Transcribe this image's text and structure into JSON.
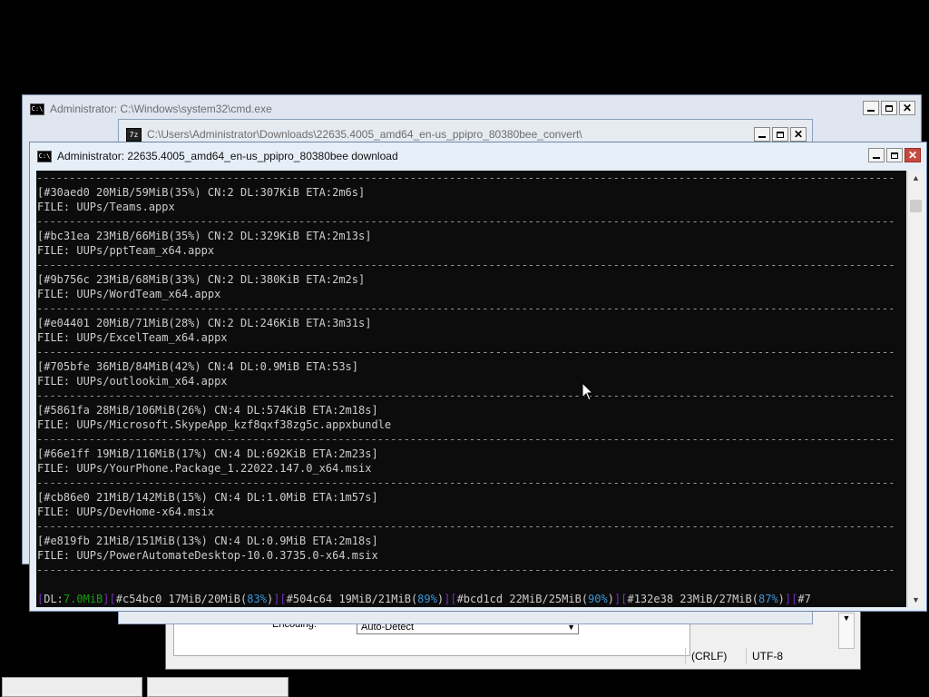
{
  "back_cmd": {
    "title": "Administrator: C:\\Windows\\system32\\cmd.exe"
  },
  "sevenz": {
    "icon_text": "7z",
    "title": "C:\\Users\\Administrator\\Downloads\\22635.4005_amd64_en-us_ppipro_80380bee_convert\\"
  },
  "notepad": {
    "encoding_label": "Encoding:",
    "encoding_value": "Auto-Detect",
    "status_line_ending": "(CRLF)",
    "status_encoding": "UTF-8"
  },
  "main": {
    "title": "Administrator:  22635.4005_amd64_en-us_ppipro_80380bee download",
    "separator": "-----------------------------------------------------------------------------------------------------------------------------------",
    "entries": [
      {
        "progress": "[#30aed0 20MiB/59MiB(35%) CN:2 DL:307KiB ETA:2m6s]",
        "file": "FILE: UUPs/Teams.appx"
      },
      {
        "progress": "[#bc31ea 23MiB/66MiB(35%) CN:2 DL:329KiB ETA:2m13s]",
        "file": "FILE: UUPs/pptTeam_x64.appx"
      },
      {
        "progress": "[#9b756c 23MiB/68MiB(33%) CN:2 DL:380KiB ETA:2m2s]",
        "file": "FILE: UUPs/WordTeam_x64.appx"
      },
      {
        "progress": "[#e04401 20MiB/71MiB(28%) CN:2 DL:246KiB ETA:3m31s]",
        "file": "FILE: UUPs/ExcelTeam_x64.appx"
      },
      {
        "progress": "[#705bfe 36MiB/84MiB(42%) CN:4 DL:0.9MiB ETA:53s]",
        "file": "FILE: UUPs/outlookim_x64.appx"
      },
      {
        "progress": "[#5861fa 28MiB/106MiB(26%) CN:4 DL:574KiB ETA:2m18s]",
        "file": "FILE: UUPs/Microsoft.SkypeApp_kzf8qxf38zg5c.appxbundle"
      },
      {
        "progress": "[#66e1ff 19MiB/116MiB(17%) CN:4 DL:692KiB ETA:2m23s]",
        "file": "FILE: UUPs/YourPhone.Package_1.22022.147.0_x64.msix"
      },
      {
        "progress": "[#cb86e0 21MiB/142MiB(15%) CN:4 DL:1.0MiB ETA:1m57s]",
        "file": "FILE: UUPs/DevHome-x64.msix"
      },
      {
        "progress": "[#e819fb 21MiB/151MiB(13%) CN:4 DL:0.9MiB ETA:2m18s]",
        "file": "FILE: UUPs/PowerAutomateDesktop-10.0.3735.0-x64.msix"
      }
    ],
    "status": {
      "dl_label": "DL:",
      "dl_value": "7.0MiB",
      "items": [
        {
          "id": "#c54bc0 17MiB/20MiB",
          "pct": "83%"
        },
        {
          "id": "#504c64 19MiB/21MiB",
          "pct": "89%"
        },
        {
          "id": "#bcd1cd 22MiB/25MiB",
          "pct": "90%"
        },
        {
          "id": "#132e38 23MiB/27MiB",
          "pct": "87%"
        }
      ],
      "tail": "#7"
    }
  }
}
